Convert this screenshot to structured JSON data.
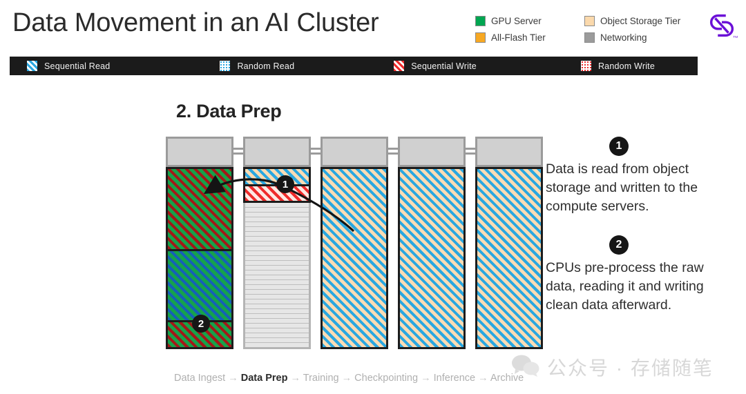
{
  "header": {
    "title": "Data Movement in an AI Cluster",
    "logo_icon": "interlocking-s-logo",
    "legend": [
      {
        "label": "GPU Server",
        "color": "#00a651",
        "icon": "color-swatch"
      },
      {
        "label": "Object Storage Tier",
        "color": "#fbd9ac",
        "icon": "color-swatch"
      },
      {
        "label": "All-Flash Tier",
        "color": "#f7a823",
        "icon": "color-swatch"
      },
      {
        "label": "Networking",
        "color": "#9b9b9b",
        "icon": "color-swatch"
      }
    ]
  },
  "pattern_bar": {
    "items": [
      {
        "label": "Sequential Read",
        "pattern": "diagonal-stripes-blue",
        "color": "#2aa7e0"
      },
      {
        "label": "Random Read",
        "pattern": "dots-blue",
        "color": "#2aa7e0"
      },
      {
        "label": "Sequential Write",
        "pattern": "diagonal-stripes-red",
        "color": "#ee2b2b"
      },
      {
        "label": "Random Write",
        "pattern": "dots-red",
        "color": "#ee2b2b"
      }
    ]
  },
  "section": {
    "title": "2. Data Prep"
  },
  "diagram": {
    "racks": [
      {
        "name": "gpu-server-rack",
        "top_label": "networking-switch",
        "segments": [
          {
            "fill": "green-sequential-write",
            "height_pct": 45
          },
          {
            "fill": "green-sequential-read",
            "height_pct": 40
          },
          {
            "fill": "green-sequential-write",
            "height_pct": 15
          }
        ]
      },
      {
        "name": "all-flash-tier-rack",
        "top_label": "networking-switch",
        "segments": [
          {
            "fill": "peach-sequential-read",
            "height_pct": 8
          },
          {
            "fill": "white-sequential-write",
            "height_pct": 9
          },
          {
            "fill": "empty-slots",
            "height_pct": 83
          }
        ]
      },
      {
        "name": "object-storage-rack-1",
        "top_label": "networking-switch",
        "segments": [
          {
            "fill": "peach-sequential-read",
            "height_pct": 100
          }
        ]
      },
      {
        "name": "object-storage-rack-2",
        "top_label": "networking-switch",
        "segments": [
          {
            "fill": "peach-sequential-read",
            "height_pct": 100
          }
        ]
      },
      {
        "name": "object-storage-rack-3",
        "top_label": "networking-switch",
        "segments": [
          {
            "fill": "peach-sequential-read",
            "height_pct": 100
          }
        ]
      }
    ],
    "badges": [
      {
        "label": "1"
      },
      {
        "label": "2"
      }
    ]
  },
  "steps": [
    {
      "number": "1",
      "text": "Data is read from object storage and written to the compute servers."
    },
    {
      "number": "2",
      "text": "CPUs pre-process the raw data, reading it and writing clean data afterward."
    }
  ],
  "breadcrumb": {
    "separator": "→",
    "items": [
      {
        "label": "Data Ingest",
        "active": false
      },
      {
        "label": "Data Prep",
        "active": true
      },
      {
        "label": "Training",
        "active": false
      },
      {
        "label": "Checkpointing",
        "active": false
      },
      {
        "label": "Inference",
        "active": false
      },
      {
        "label": "Archive",
        "active": false
      }
    ]
  },
  "watermark": {
    "icon": "wechat-icon",
    "text": "公众号 · 存储随笔"
  }
}
